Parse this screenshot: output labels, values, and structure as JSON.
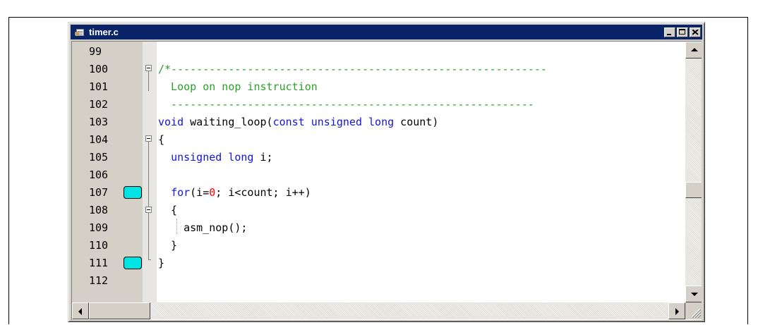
{
  "window": {
    "title": "timer.c",
    "icon": "c-source-file-icon"
  },
  "editor": {
    "lines": [
      {
        "num": "99",
        "breakpoint": false,
        "parts": []
      },
      {
        "num": "100",
        "breakpoint": false,
        "parts": [
          {
            "t": "/*-----------------------------------------------------------",
            "c": "comment"
          }
        ]
      },
      {
        "num": "101",
        "breakpoint": false,
        "parts": [
          {
            "t": "  Loop on nop instruction",
            "c": "comment"
          }
        ]
      },
      {
        "num": "102",
        "breakpoint": false,
        "parts": [
          {
            "t": "  ---------------------------------------------------------",
            "c": "comment"
          }
        ]
      },
      {
        "num": "103",
        "breakpoint": false,
        "parts": [
          {
            "t": "void",
            "c": "kw"
          },
          {
            "t": " waiting_loop(",
            "c": "txt"
          },
          {
            "t": "const unsigned long",
            "c": "kw"
          },
          {
            "t": " count)",
            "c": "txt"
          }
        ]
      },
      {
        "num": "104",
        "breakpoint": false,
        "parts": [
          {
            "t": "{",
            "c": "txt"
          }
        ]
      },
      {
        "num": "105",
        "breakpoint": false,
        "parts": [
          {
            "t": "  ",
            "c": "txt"
          },
          {
            "t": "unsigned long",
            "c": "kw"
          },
          {
            "t": " i;",
            "c": "txt"
          }
        ]
      },
      {
        "num": "106",
        "breakpoint": false,
        "parts": []
      },
      {
        "num": "107",
        "breakpoint": true,
        "parts": [
          {
            "t": "  ",
            "c": "txt"
          },
          {
            "t": "for",
            "c": "kw"
          },
          {
            "t": "(i=",
            "c": "txt"
          },
          {
            "t": "0",
            "c": "num"
          },
          {
            "t": "; i<count; i++)",
            "c": "txt"
          }
        ]
      },
      {
        "num": "108",
        "breakpoint": false,
        "parts": [
          {
            "t": "  {",
            "c": "txt"
          }
        ]
      },
      {
        "num": "109",
        "breakpoint": false,
        "parts": [
          {
            "t": "    asm_nop();",
            "c": "txt"
          }
        ]
      },
      {
        "num": "110",
        "breakpoint": false,
        "parts": [
          {
            "t": "  }",
            "c": "txt"
          }
        ]
      },
      {
        "num": "111",
        "breakpoint": true,
        "parts": [
          {
            "t": "}",
            "c": "txt"
          }
        ]
      },
      {
        "num": "112",
        "breakpoint": false,
        "parts": []
      }
    ]
  },
  "colors": {
    "titlebar": "#0a246a",
    "comment": "#2aa12a",
    "keyword": "#1515d8",
    "number": "#ff0000",
    "breakpoint": "#00e4e4"
  }
}
